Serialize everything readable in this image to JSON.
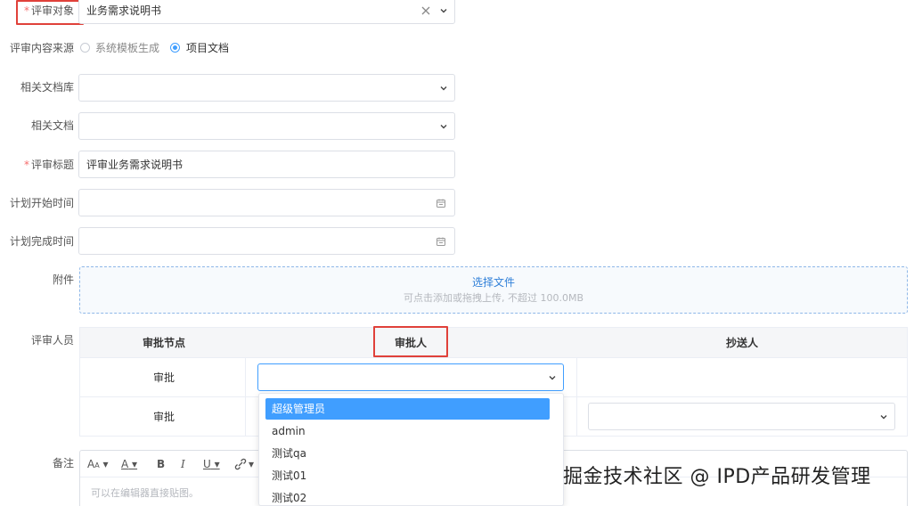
{
  "form": {
    "review_object": {
      "label": "评审对象",
      "value": "业务需求说明书"
    },
    "content_source": {
      "label": "评审内容来源",
      "option1": "系统模板生成",
      "option2": "项目文档",
      "selected": "项目文档"
    },
    "doc_library": {
      "label": "相关文档库",
      "value": ""
    },
    "related_doc": {
      "label": "相关文档",
      "value": ""
    },
    "review_title": {
      "label": "评审标题",
      "value": "评审业务需求说明书"
    },
    "plan_start": {
      "label": "计划开始时间",
      "value": ""
    },
    "plan_end": {
      "label": "计划完成时间",
      "value": ""
    },
    "attachment": {
      "label": "附件",
      "action": "选择文件",
      "hint": "可点击添加或拖拽上传, 不超过 100.0MB"
    },
    "reviewers": {
      "label": "评审人员",
      "headers": {
        "node": "审批节点",
        "approver": "审批人",
        "cc": "抄送人"
      },
      "rows": [
        {
          "node": "审批",
          "approver": "",
          "cc": ""
        },
        {
          "node": "审批",
          "approver": "",
          "cc": ""
        }
      ]
    },
    "remarks": {
      "label": "备注",
      "placeholder": "可以在编辑器直接贴图。"
    }
  },
  "approver_dropdown": {
    "options": [
      "超级管理员",
      "admin",
      "测试qa",
      "测试01",
      "测试02"
    ],
    "highlighted": "超级管理员"
  },
  "editor_toolbar": {
    "font_size_label": "A",
    "font_size_small": "A",
    "font_color_label": "A",
    "bold_label": "B",
    "italic_label": "I",
    "underline_label": "U"
  },
  "watermark": "掘金技术社区 @ IPD产品研发管理",
  "colors": {
    "accent": "#409eff",
    "required": "#f56c6c",
    "highlight_box": "#e0413a"
  }
}
